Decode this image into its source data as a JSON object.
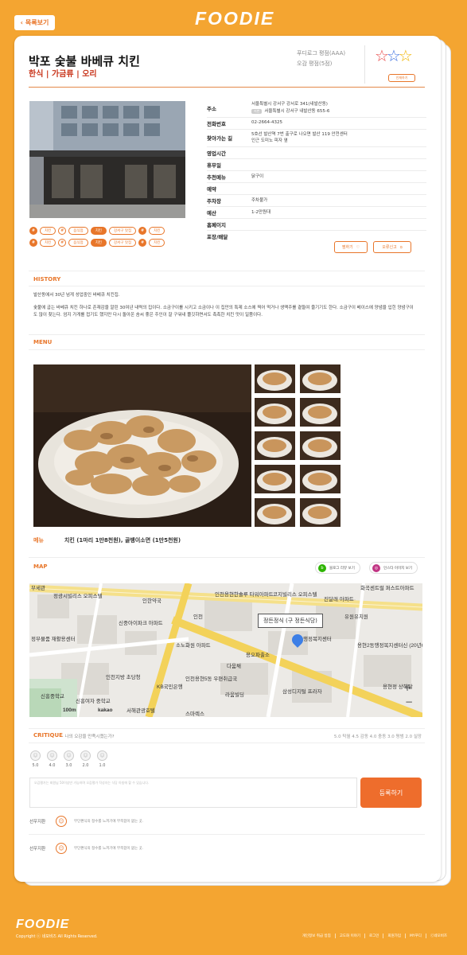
{
  "header": {
    "back_label": "목록보기",
    "logo": "FOODIE"
  },
  "restaurant": {
    "name": "박포 숯불 바베큐 치킨",
    "category": "한식 | 가금류 | 오리",
    "rating_foodie": "푸디로그 평점(AAA)",
    "rating_sense": "오감 평점(5점)",
    "stars": "☆☆☆",
    "info_chip": "인재하기"
  },
  "tags_row1": [
    "치킨",
    "음식점",
    "치킨",
    "강서구 맛집",
    "치킨"
  ],
  "tags_row2": [
    "치킨",
    "음식점",
    "치킨",
    "강서구 맛집",
    "치킨"
  ],
  "info": [
    {
      "k": "주소",
      "v": "서울특별시 강서구 강서로 341(내발산동)",
      "v2": "서울특별시 강서구 내발산동 655-6",
      "chip": "지번"
    },
    {
      "k": "전화번호",
      "v": "02-2664-4325"
    },
    {
      "k": "찾아가는 길",
      "v": "5호선 발산역 7번 출구로 나오면 발산 119 안전센터",
      "v2": "인근 도미노 피자 옆"
    },
    {
      "k": "영업시간",
      "v": ""
    },
    {
      "k": "휴무일",
      "v": ""
    },
    {
      "k": "추천메뉴",
      "v": "닭구이"
    },
    {
      "k": "예약",
      "v": ""
    },
    {
      "k": "주차장",
      "v": "주차불가"
    },
    {
      "k": "예산",
      "v": "1-2만원대"
    },
    {
      "k": "홈페이지",
      "v": ""
    },
    {
      "k": "포장/배달",
      "v": ""
    }
  ],
  "actions": {
    "like": "찜하기",
    "report": "오류신고"
  },
  "history": {
    "title": "HISTORY",
    "p1": "발산동에서 30년 넘게 성업중인 바베큐 치킨집.",
    "p2": "숯불에 굽는 바베큐 치킨 하나로 존재감을 알린 30여년 내력의 집이다. 소금구이를 시키고 소금이나 이 집만의 특제 소스에 찍어 먹거나 생맥주를 곁들여 즐기기도 한다. 소금구이 베이스에 양념을 입힌 양념구이도 많이 찾는다. 엄지 가게를 접기도 했지만 다시 돌아온 솜씨 좋은 주인이 잘 구워내 쫄깃하면서도 촉촉한 치킨 맛이 일품이다."
  },
  "menu": {
    "title": "MENU",
    "label": "메뉴",
    "items": "치킨 (1마리 1만8천원), 골뱅이소면 (1만5천원)"
  },
  "map": {
    "title": "MAP",
    "blog_btn": "블로그 리뷰 보기",
    "insta_btn": "인스타 이미지 보기",
    "popup": "정든정식 (구 정든식당)",
    "scale": "100m",
    "labels": [
      "부세관",
      "정광시빌리스 오피스텔",
      "인한약국",
      "인천용현한솔루 타워아파트",
      "코지빌리스 오피스텔",
      "진달래 아파트",
      "화곡센트럴 퍼스트아파트",
      "유원유치원",
      "신중아이파크 아파트",
      "인천",
      "정부물품 재활용센터",
      "행정복지센터",
      "용현2동행정복지센터신 (20년6월예정)",
      "소노화원 아파트",
      "용오파출소",
      "다움채",
      "인천지방 초당청",
      "KB국민은행",
      "인천용현5동 우편취급국",
      "라움빌딩",
      "삼성디지털 프라자",
      "용현정 상해탈",
      "신흥중학교",
      "신흥여자 중학교",
      "서해관광호텔",
      "스마렉스",
      "kakao"
    ]
  },
  "critique": {
    "title": "CRITIQUE",
    "sub": "· 나의 오감을 만족시켰는가?",
    "score": "5.0 탁월 4.5 감동 4.0 충동 3.0 평범 2.0 실망",
    "faces": [
      "5.0",
      "4.0",
      "3.0",
      "2.0",
      "1.0"
    ],
    "placeholder": "오감평가는 회원님 50이상만 가능하며 오감평가 작성자는 식당 아침에 할 수 있습니다.",
    "submit": "등록하기"
  },
  "reviews": [
    {
      "user": "선우지환",
      "text": "무단편식의 정수를 느끼기에 부족함이 없는 곳."
    },
    {
      "user": "선우지환",
      "text": "무단편식의 정수를 느끼기에 부족함이 없는 곳."
    }
  ],
  "footer": {
    "logo": "FOODIE",
    "copyright": "Copyright ⓒ 네모비즈 All Rights Reserved.",
    "links": [
      "개인정보 취급 방침",
      "고도화 이야기",
      "로그인",
      "회원가입",
      "MY푸디",
      "ⓒ네모비즈"
    ]
  }
}
